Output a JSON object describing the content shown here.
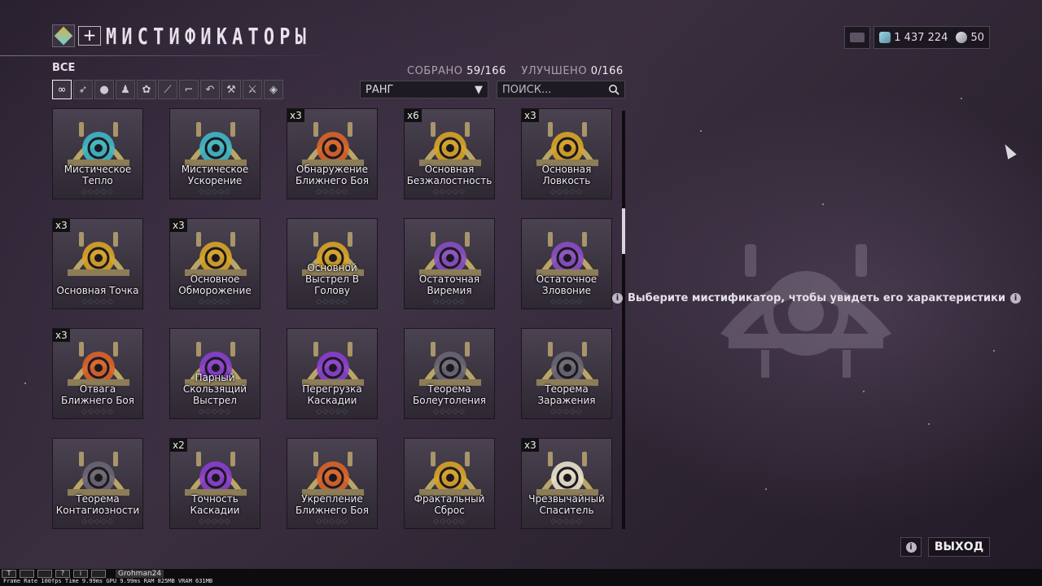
{
  "header": {
    "title": "МИСТИФИКАТОРЫ",
    "add_label": "+"
  },
  "currency": {
    "credits": "1 437 224",
    "platinum": "50"
  },
  "filter": {
    "label": "ВСЕ",
    "categories": [
      "infinity-icon",
      "bird-icon",
      "person-icon",
      "figure-icon",
      "flower-icon",
      "rifle-icon",
      "pistol-icon",
      "scythe-icon",
      "wrench-icon",
      "crossed-swords-icon",
      "diamond-icon"
    ]
  },
  "stats": {
    "collected_label": "СОБРАНО",
    "collected_value": "59/166",
    "upgraded_label": "УЛУЧШЕНО",
    "upgraded_value": "0/166"
  },
  "sort": {
    "selected": "РАНГ"
  },
  "search": {
    "placeholder": "ПОИСК..."
  },
  "arcanes": [
    {
      "name": "Мистическое Тепло",
      "count": "",
      "color": "#3fb8c8",
      "rank": "◇◇◇◇◇"
    },
    {
      "name": "Мистическое Ускорение",
      "count": "",
      "color": "#3fb8c8",
      "rank": "◇◇◇◇◇"
    },
    {
      "name": "Обнаружение Ближнего Боя",
      "count": "x3",
      "color": "#d9642a",
      "rank": "◇◇◇◇◇"
    },
    {
      "name": "Основная Безжалостность",
      "count": "x6",
      "color": "#d8a428",
      "rank": "◇◇◇◇◇"
    },
    {
      "name": "Основная Ловкость",
      "count": "x3",
      "color": "#d8a428",
      "rank": "◇◇◇◇◇"
    },
    {
      "name": "Основная Точка",
      "count": "x3",
      "color": "#d8a428",
      "rank": "◇◇◇◇◇"
    },
    {
      "name": "Основное Обморожение",
      "count": "x3",
      "color": "#d8a428",
      "rank": "◇◇◇◇◇"
    },
    {
      "name": "Основной Выстрел В Голову",
      "count": "",
      "color": "#d8a428",
      "rank": "◇◇◇◇◇"
    },
    {
      "name": "Остаточная Виремия",
      "count": "",
      "color": "#8a4fc4",
      "rank": "◇◇◇◇◇"
    },
    {
      "name": "Остаточное Зловоние",
      "count": "",
      "color": "#8a4fc4",
      "rank": "◇◇◇◇◇"
    },
    {
      "name": "Отвага Ближнего Боя",
      "count": "x3",
      "color": "#d9642a",
      "rank": "◇◇◇◇◇"
    },
    {
      "name": "Парный Скользящий Выстрел",
      "count": "",
      "color": "#8a3fd0",
      "rank": "◇◇◇◇◇"
    },
    {
      "name": "Перегрузка Каскадии",
      "count": "",
      "color": "#8a3fd0",
      "rank": "◇◇◇◇◇"
    },
    {
      "name": "Теорема Болеутоления",
      "count": "",
      "color": "#6a6674",
      "rank": "◇◇◇◇◇"
    },
    {
      "name": "Теорема Заражения",
      "count": "",
      "color": "#6a6674",
      "rank": "◇◇◇◇◇"
    },
    {
      "name": "Теорема Контагиозности",
      "count": "",
      "color": "#6a6674",
      "rank": "◇◇◇◇◇"
    },
    {
      "name": "Точность Каскадии",
      "count": "x2",
      "color": "#8a3fd0",
      "rank": "◇◇◇◇◇"
    },
    {
      "name": "Укрепление Ближнего Боя",
      "count": "",
      "color": "#d9642a",
      "rank": "◇◇◇◇◇"
    },
    {
      "name": "Фрактальный Сброс",
      "count": "",
      "color": "#d8a428",
      "rank": "◇◇◇◇◇"
    },
    {
      "name": "Чрезвычайный Спаситель",
      "count": "x3",
      "color": "#e8e2cc",
      "rank": "◇◇◇◇◇"
    }
  ],
  "detail": {
    "hint": "Выберите мистификатор, чтобы увидеть его характеристики"
  },
  "footer": {
    "exit_label": "ВЫХОД",
    "info_icon": "i"
  },
  "debug": {
    "user": "Grohman24",
    "overlay": "Frame Rate 100fps Time 9.99ms GPU 9.99ms RAM 825MB VRAM 631MB"
  }
}
